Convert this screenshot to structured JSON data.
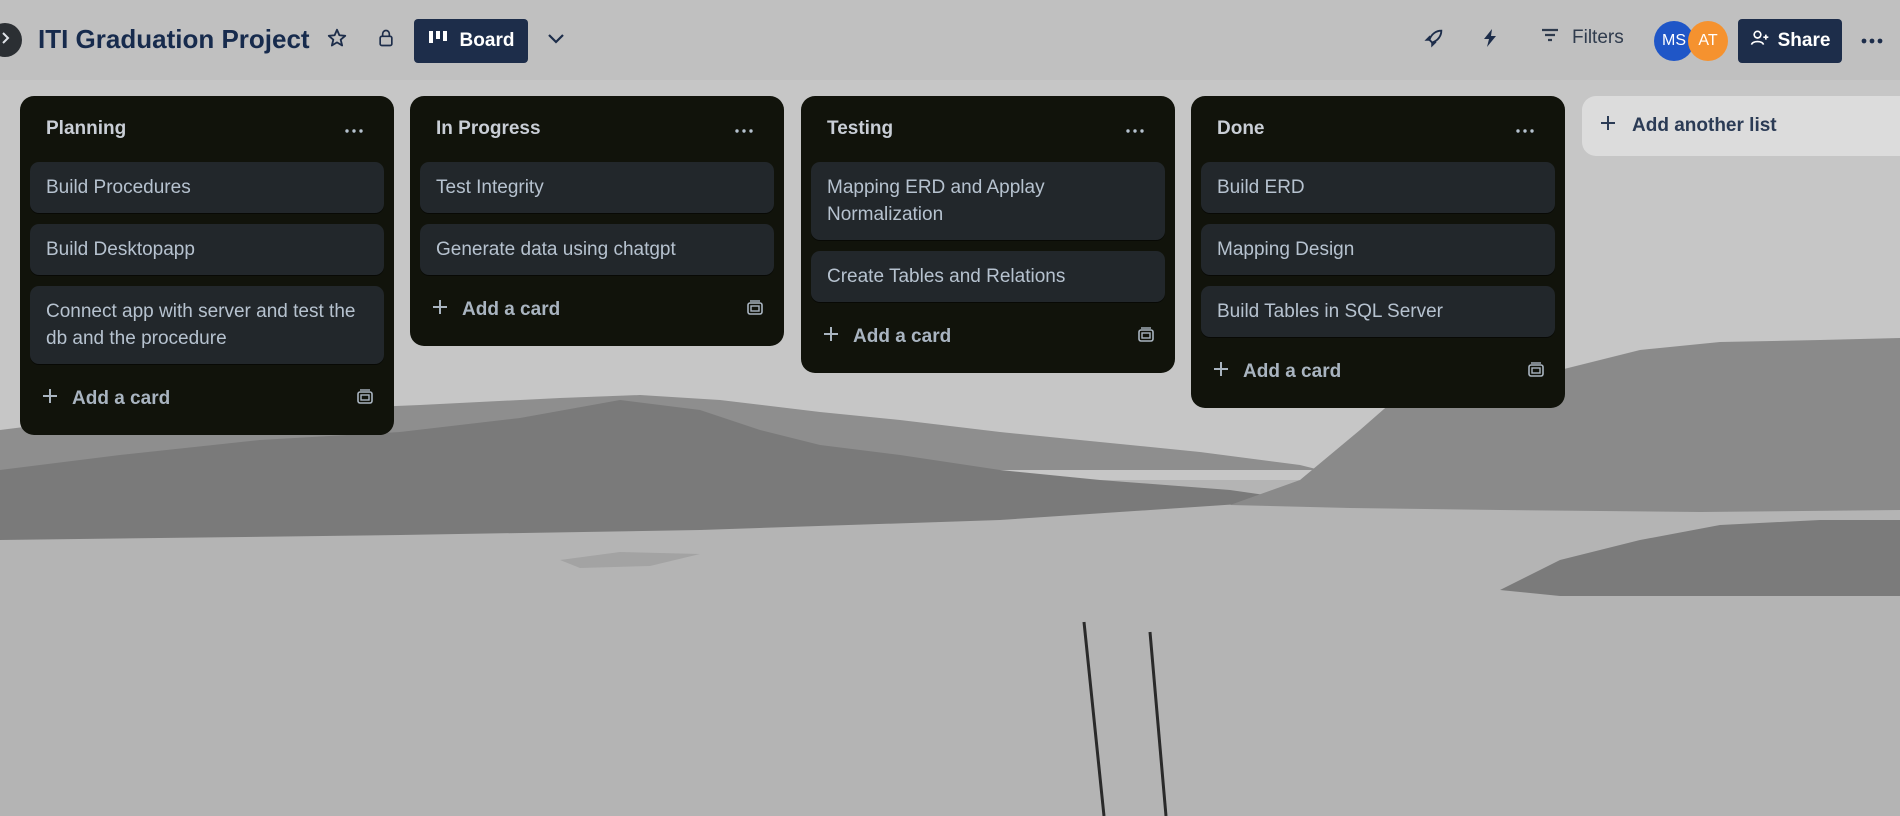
{
  "header": {
    "board_title": "ITI Graduation Project",
    "view_label": "Board",
    "filters_label": "Filters",
    "share_label": "Share",
    "members": [
      {
        "initials": "MS",
        "color": "#1f56c7"
      },
      {
        "initials": "AT",
        "color": "#f5922f"
      }
    ]
  },
  "icons": {
    "collapse": "chevron-right-icon",
    "star": "star-icon",
    "visibility": "lock-icon",
    "view": "board-icon",
    "view_switch": "chevron-down-icon",
    "power_ups": "rocket-icon",
    "automation": "lightning-icon",
    "filter": "filter-icon",
    "share": "add-person-icon",
    "more": "more-icon",
    "card_template": "card-template-icon",
    "add": "plus-icon"
  },
  "lists": [
    {
      "title": "Planning",
      "cards": [
        "Build Procedures",
        "Build Desktopapp",
        "Connect app with server and test the db and the procedure"
      ],
      "add_card_label": "Add a card"
    },
    {
      "title": "In Progress",
      "cards": [
        "Test Integrity",
        "Generate data using chatgpt"
      ],
      "add_card_label": "Add a card"
    },
    {
      "title": "Testing",
      "cards": [
        "Mapping ERD and Applay Normalization",
        "Create Tables and Relations"
      ],
      "add_card_label": "Add a card"
    },
    {
      "title": "Done",
      "cards": [
        "Build ERD",
        "Mapping Design",
        "Build Tables in SQL Server"
      ],
      "add_card_label": "Add a card"
    }
  ],
  "add_list_label": "Add another list"
}
